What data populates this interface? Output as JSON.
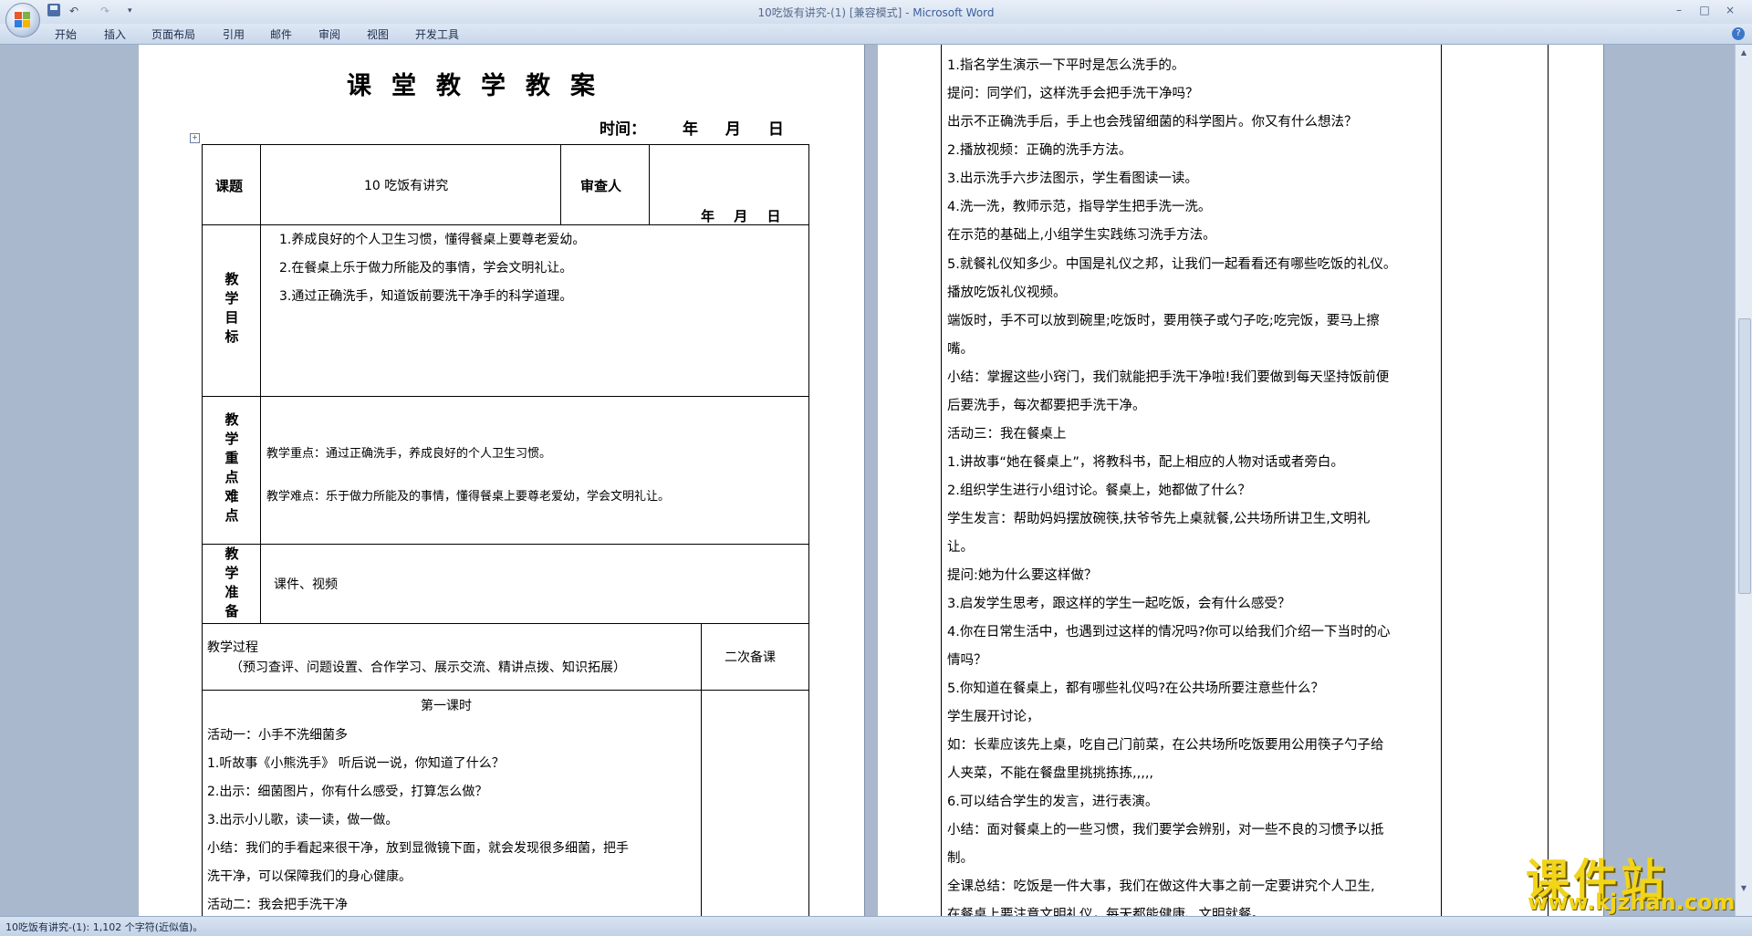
{
  "window": {
    "title": "10吃饭有讲究-(1) [兼容模式] - ",
    "app": "Microsoft Word",
    "controls": [
      "–",
      "□",
      "×"
    ]
  },
  "ribbon_tabs": [
    "开始",
    "插入",
    "页面布局",
    "引用",
    "邮件",
    "审阅",
    "视图",
    "开发工具"
  ],
  "quick_access": {
    "undo": "↶",
    "redo": "↷",
    "more": "▾"
  },
  "help": "?",
  "page1": {
    "title": "课堂教学教案",
    "time_label": "时间：",
    "time_value": "年 月 日",
    "row1": {
      "label": "课题",
      "lesson": "10 吃饭有讲究",
      "reviewer_label": "审查人",
      "date": "年 月 日"
    },
    "goals_label": "教学目标",
    "goals": [
      "1.养成良好的个人卫生习惯，懂得餐桌上要尊老爱幼。",
      "2.在餐桌上乐于做力所能及的事情，学会文明礼让。",
      "3.通过正确洗手，知道饭前要洗干净手的科学道理。"
    ],
    "focus_label": "教学重点难点",
    "focus_key": "教学重点：通过正确洗手，养成良好的个人卫生习惯。",
    "focus_hard": "教学难点：乐于做力所能及的事情，懂得餐桌上要尊老爱幼，学会文明礼让。",
    "prep_label": "教学准备",
    "prep": "课件、视频",
    "process_label": "教学过程",
    "process_sub": "（预习查评、问题设置、合作学习、展示交流、精讲点拨、知识拓展）",
    "second_prep": "二次备课",
    "lesson1": "第一课时",
    "body": [
      "活动一：小手不洗细菌多",
      "1.听故事《小熊洗手》 听后说一说，你知道了什么？",
      "2.出示：细菌图片，你有什么感受，打算怎么做？",
      "3.出示小儿歌，读一读，做一做。",
      "小结：我们的手看起来很干净，放到显微镜下面，就会发现很多细菌，把手",
      "洗干净，可以保障我们的身心健康。",
      "活动二：我会把手洗干净"
    ]
  },
  "page2": {
    "lines": [
      "1.指名学生演示一下平时是怎么洗手的。",
      "提问：同学们，这样洗手会把手洗干净吗？",
      "出示不正确洗手后，手上也会残留细菌的科学图片。你又有什么想法？",
      "2.播放视频：正确的洗手方法。",
      "3.出示洗手六步法图示，学生看图读一读。",
      "4.洗一洗，教师示范，指导学生把手洗一洗。",
      "在示范的基础上,小组学生实践练习洗手方法。",
      "5.就餐礼仪知多少。中国是礼仪之邦，让我们一起看看还有哪些吃饭的礼仪。",
      "播放吃饭礼仪视频。",
      "端饭时，手不可以放到碗里;吃饭时，要用筷子或勺子吃;吃完饭，要马上擦",
      "嘴。",
      "小结：掌握这些小窍门，我们就能把手洗干净啦!我们要做到每天坚持饭前便",
      "后要洗手，每次都要把手洗干净。",
      "活动三：我在餐桌上",
      "1.讲故事“她在餐桌上”，将教科书，配上相应的人物对话或者旁白。",
      "2.组织学生进行小组讨论。餐桌上，她都做了什么？",
      "学生发言：帮助妈妈摆放碗筷,扶爷爷先上桌就餐,公共场所讲卫生,文明礼",
      "让。",
      "提问:她为什么要这样做？",
      "3.启发学生思考，跟这样的学生一起吃饭，会有什么感受？",
      "4.你在日常生活中，也遇到过这样的情况吗?你可以给我们介绍一下当时的心",
      "情吗？",
      "5.你知道在餐桌上，都有哪些礼仪吗?在公共场所要注意些什么？",
      "学生展开讨论，",
      "如：长辈应该先上桌，吃自己门前菜，在公共场所吃饭要用公用筷子勺子给",
      "人夹菜，不能在餐盘里挑挑拣拣,,,,,",
      "6.可以结合学生的发言，进行表演。",
      "小结：面对餐桌上的一些习惯，我们要学会辨别，对一些不良的习惯予以抵",
      "制。",
      "全课总结：吃饭是一件大事，我们在做这件大事之前一定要讲究个人卫生,",
      "在餐桌上要注意文明礼仪，每天都能健康、文明就餐。"
    ]
  },
  "status": "10吃饭有讲究-(1): 1,102 个字符(近似值)。",
  "watermark": {
    "brand": "课件站",
    "url": "www.kjzhan.com"
  }
}
